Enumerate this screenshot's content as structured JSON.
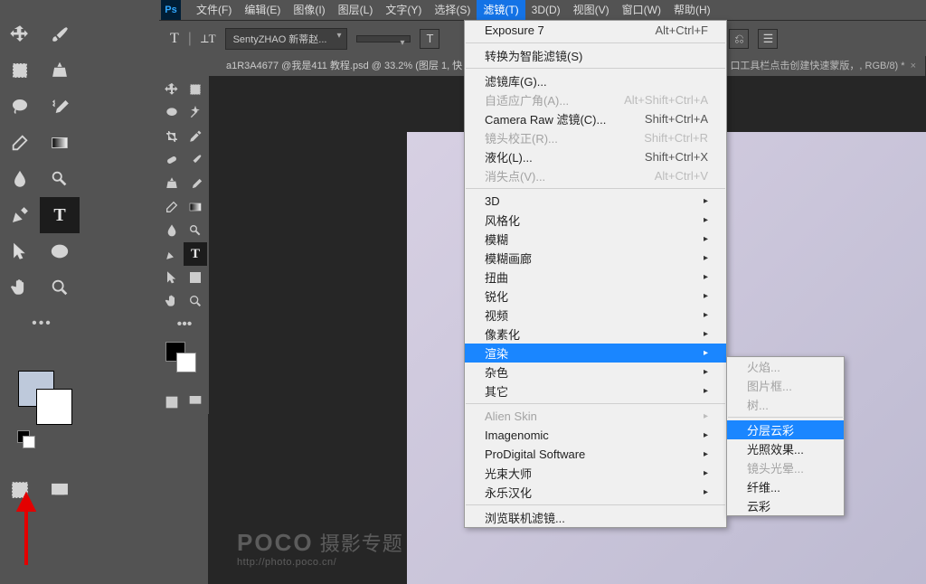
{
  "menubar": {
    "items": [
      "文件(F)",
      "编辑(E)",
      "图像(I)",
      "图层(L)",
      "文字(Y)",
      "选择(S)",
      "滤镜(T)",
      "3D(D)",
      "视图(V)",
      "窗口(W)",
      "帮助(H)"
    ],
    "open_index": 6
  },
  "optbar": {
    "font": "SentyZHAO 新蒂赵..."
  },
  "document_tabs": {
    "tab1": "a1R3A4677 @我是411 教程.psd @ 33.2% (图层 1, 快",
    "tab2_fragment": "口工具栏点击创建快速蒙版，, RGB/8) *"
  },
  "filter_menu": {
    "g1": [
      {
        "label": "Exposure 7",
        "shortcut": "Alt+Ctrl+F"
      }
    ],
    "g2": [
      {
        "label": "转换为智能滤镜(S)"
      }
    ],
    "g3": [
      {
        "label": "滤镜库(G)..."
      },
      {
        "label": "自适应广角(A)...",
        "shortcut": "Alt+Shift+Ctrl+A",
        "disabled": true
      },
      {
        "label": "Camera Raw 滤镜(C)...",
        "shortcut": "Shift+Ctrl+A"
      },
      {
        "label": "镜头校正(R)...",
        "shortcut": "Shift+Ctrl+R",
        "disabled": true
      },
      {
        "label": "液化(L)...",
        "shortcut": "Shift+Ctrl+X"
      },
      {
        "label": "消失点(V)...",
        "shortcut": "Alt+Ctrl+V",
        "disabled": true
      }
    ],
    "g4": [
      {
        "label": "3D",
        "sub": true
      },
      {
        "label": "风格化",
        "sub": true
      },
      {
        "label": "模糊",
        "sub": true
      },
      {
        "label": "模糊画廊",
        "sub": true
      },
      {
        "label": "扭曲",
        "sub": true
      },
      {
        "label": "锐化",
        "sub": true
      },
      {
        "label": "视频",
        "sub": true
      },
      {
        "label": "像素化",
        "sub": true
      },
      {
        "label": "渲染",
        "sub": true,
        "hl": true
      },
      {
        "label": "杂色",
        "sub": true
      },
      {
        "label": "其它",
        "sub": true
      }
    ],
    "g5": [
      {
        "label": "Alien Skin",
        "sub": true,
        "disabled": true
      },
      {
        "label": "Imagenomic",
        "sub": true
      },
      {
        "label": "ProDigital Software",
        "sub": true
      },
      {
        "label": "光束大师",
        "sub": true
      },
      {
        "label": "永乐汉化",
        "sub": true
      }
    ],
    "g6": [
      {
        "label": "浏览联机滤镜..."
      }
    ]
  },
  "render_submenu": [
    {
      "label": "火焰...",
      "disabled": true
    },
    {
      "label": "图片框...",
      "disabled": true
    },
    {
      "label": "树...",
      "disabled": true
    },
    {
      "sep": true
    },
    {
      "label": "分层云彩",
      "hl": true
    },
    {
      "label": "光照效果..."
    },
    {
      "label": "镜头光晕...",
      "disabled": true
    },
    {
      "label": "纤维..."
    },
    {
      "label": "云彩"
    }
  ],
  "watermark": {
    "brand": "POCO",
    "sub": "摄影专题",
    "url": "http://photo.poco.cn/"
  }
}
